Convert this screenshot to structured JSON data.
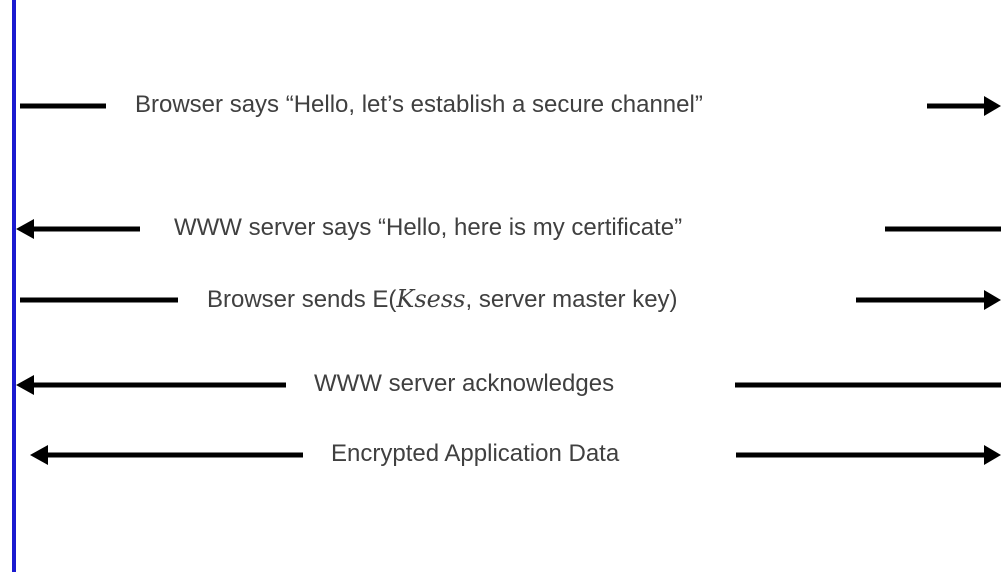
{
  "diagram": {
    "accent_color": "#1a1ad0",
    "arrow_color": "#000000",
    "messages": [
      {
        "text": "Browser says “Hello, let’s establish a secure channel”",
        "direction": "right"
      },
      {
        "text": "WWW server says “Hello, here is my certificate”",
        "direction": "left"
      },
      {
        "text_before": "Browser sends E(",
        "text_math": "Ksess",
        "text_after": ", server master key)",
        "direction": "right"
      },
      {
        "text": "WWW server acknowledges",
        "direction": "left"
      },
      {
        "text": "Encrypted Application Data",
        "direction": "both"
      }
    ]
  }
}
